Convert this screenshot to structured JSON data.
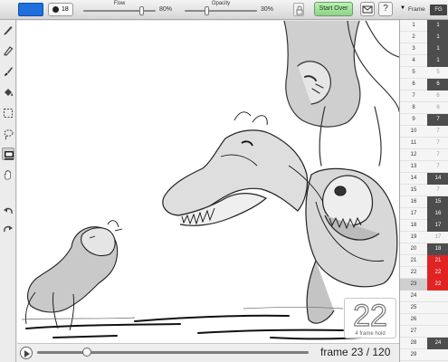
{
  "toolbar": {
    "color_swatch": "#1f6fdc",
    "brush_size": "18",
    "flow": {
      "label": "Flow",
      "value": "80%",
      "level": 0.8
    },
    "opacity": {
      "label": "Opacity",
      "value": "30%",
      "level": 0.3
    },
    "start_over_label": "Start Over",
    "mail_icon": "envelope-icon",
    "help_label": "?",
    "frame_header_label": "Frame",
    "fg_label": "FG"
  },
  "tools": [
    "pencil-icon",
    "marker-icon",
    "brush-icon",
    "fill-bucket-icon",
    "rect-select-icon",
    "lasso-icon",
    "stamp-icon",
    "hand-icon",
    "undo-icon",
    "redo-icon"
  ],
  "canvas": {
    "badge_number": "22",
    "badge_caption": "4 frame hold"
  },
  "timeline": {
    "counter": "frame 23 / 120",
    "position": 0.183
  },
  "frames": [
    {
      "n": "1",
      "cell": "1",
      "type": "key"
    },
    {
      "n": "2",
      "cell": "1",
      "type": "key"
    },
    {
      "n": "3",
      "cell": "1",
      "type": "key"
    },
    {
      "n": "4",
      "cell": "1",
      "type": "key"
    },
    {
      "n": "5",
      "cell": "5",
      "type": "hold"
    },
    {
      "n": "6",
      "cell": "6",
      "type": "key"
    },
    {
      "n": "7",
      "cell": "6",
      "type": "hold"
    },
    {
      "n": "8",
      "cell": "6",
      "type": "hold"
    },
    {
      "n": "9",
      "cell": "7",
      "type": "key"
    },
    {
      "n": "10",
      "cell": "7",
      "type": "hold"
    },
    {
      "n": "11",
      "cell": "7",
      "type": "hold"
    },
    {
      "n": "12",
      "cell": "7",
      "type": "hold"
    },
    {
      "n": "13",
      "cell": "7",
      "type": "hold"
    },
    {
      "n": "14",
      "cell": "14",
      "type": "key"
    },
    {
      "n": "15",
      "cell": "7",
      "type": "hold"
    },
    {
      "n": "16",
      "cell": "15",
      "type": "key"
    },
    {
      "n": "17",
      "cell": "16",
      "type": "key"
    },
    {
      "n": "18",
      "cell": "17",
      "type": "key"
    },
    {
      "n": "19",
      "cell": "17",
      "type": "hold"
    },
    {
      "n": "20",
      "cell": "18",
      "type": "key"
    },
    {
      "n": "21",
      "cell": "21",
      "type": "cur"
    },
    {
      "n": "22",
      "cell": "22",
      "type": "cur"
    },
    {
      "n": "23",
      "cell": "22",
      "type": "current"
    },
    {
      "n": "24",
      "cell": "",
      "type": "hold"
    },
    {
      "n": "25",
      "cell": "",
      "type": "hold"
    },
    {
      "n": "26",
      "cell": "",
      "type": "hold"
    },
    {
      "n": "27",
      "cell": "",
      "type": "hold"
    },
    {
      "n": "28",
      "cell": "24",
      "type": "key"
    },
    {
      "n": "29",
      "cell": "",
      "type": "hold"
    }
  ]
}
